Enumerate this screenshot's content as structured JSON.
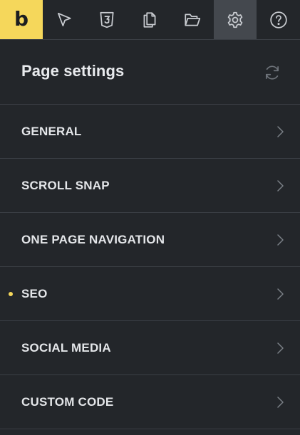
{
  "toolbar": {
    "logo_letter": "b",
    "tools": [
      {
        "name": "select-element-button",
        "icon": "cursor-arrow-icon"
      },
      {
        "name": "css-classes-button",
        "icon": "css3-icon"
      },
      {
        "name": "pages-button",
        "icon": "pages-icon"
      },
      {
        "name": "templates-button",
        "icon": "folder-open-icon"
      },
      {
        "name": "settings-button",
        "icon": "gear-icon",
        "active": true
      },
      {
        "name": "help-button",
        "icon": "help-circle-icon"
      }
    ],
    "colors": {
      "logo_bg": "#f5d75b",
      "active_bg": "#44484e",
      "icon": "#c9ccd1"
    }
  },
  "header": {
    "title": "Page settings",
    "reset_icon": "refresh-icon"
  },
  "menu": {
    "items": [
      {
        "label": "GENERAL",
        "modified": false
      },
      {
        "label": "SCROLL SNAP",
        "modified": false
      },
      {
        "label": "ONE PAGE NAVIGATION",
        "modified": false
      },
      {
        "label": "SEO",
        "modified": true
      },
      {
        "label": "SOCIAL MEDIA",
        "modified": false
      },
      {
        "label": "CUSTOM CODE",
        "modified": false
      }
    ],
    "chevron_icon": "chevron-right-icon",
    "modified_color": "#f5d75b"
  }
}
